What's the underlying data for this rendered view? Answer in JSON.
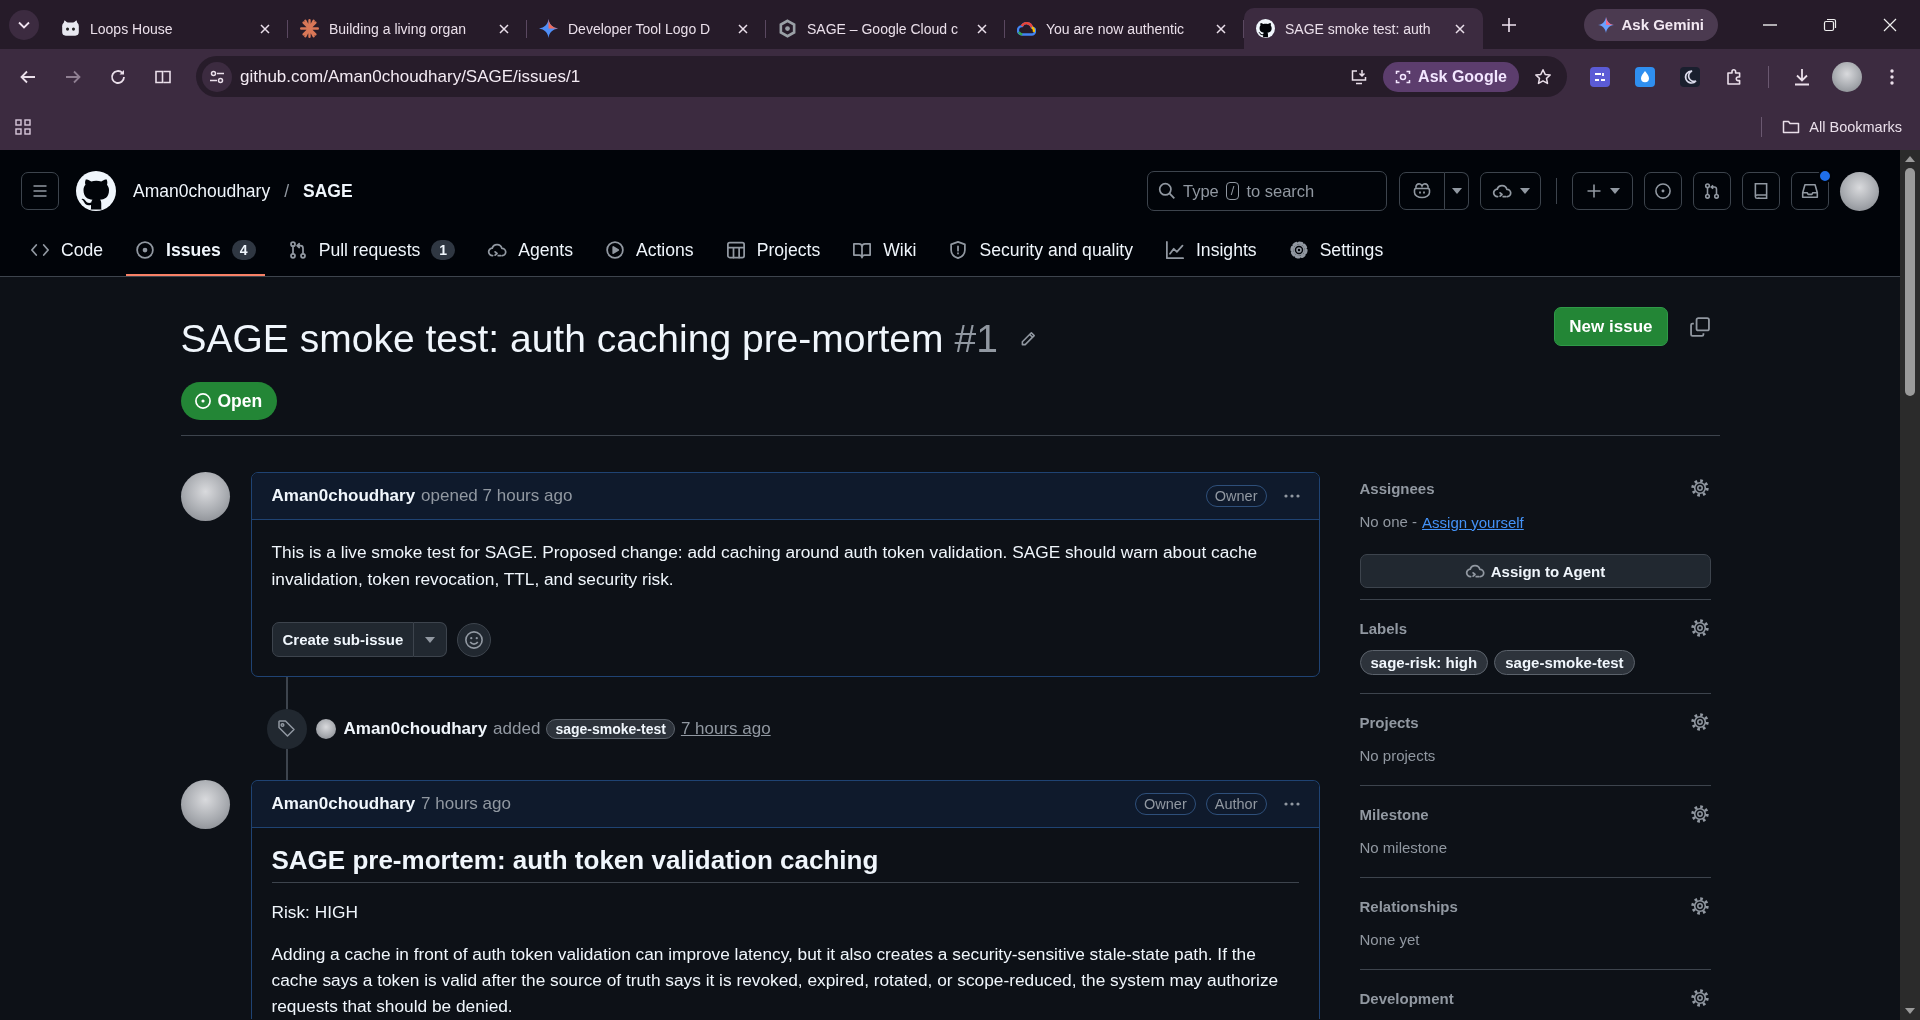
{
  "browser": {
    "tabs": [
      {
        "title": "Loops House",
        "selected": false
      },
      {
        "title": "Building a living organ",
        "selected": false
      },
      {
        "title": "Developer Tool Logo D",
        "selected": false
      },
      {
        "title": "SAGE – Google Cloud c",
        "selected": false
      },
      {
        "title": "You are now authentic",
        "selected": false
      },
      {
        "title": "SAGE smoke test: auth",
        "selected": true
      }
    ],
    "ask_gemini": "Ask Gemini",
    "url": "github.com/Aman0choudhary/SAGE/issues/1",
    "ask_google": "Ask Google",
    "all_bookmarks": "All Bookmarks"
  },
  "header": {
    "owner": "Aman0choudhary",
    "separator": "/",
    "repo": "SAGE",
    "search": {
      "hint_start": "Type",
      "key": "/",
      "hint_end": "to search"
    },
    "inbox": {
      "unread": true
    }
  },
  "repo_nav": [
    {
      "label": "Code",
      "selected": false
    },
    {
      "label": "Issues",
      "counter": "4",
      "selected": true
    },
    {
      "label": "Pull requests",
      "counter": "1",
      "selected": false
    },
    {
      "label": "Agents",
      "selected": false
    },
    {
      "label": "Actions",
      "selected": false
    },
    {
      "label": "Projects",
      "selected": false
    },
    {
      "label": "Wiki",
      "selected": false
    },
    {
      "label": "Security and quality",
      "selected": false
    },
    {
      "label": "Insights",
      "selected": false
    },
    {
      "label": "Settings",
      "selected": false
    }
  ],
  "issue": {
    "title": "SAGE smoke test: auth caching pre-mortem",
    "number": "#1",
    "new_issue": "New issue",
    "state": {
      "kind": "open",
      "label": "Open"
    }
  },
  "timeline": [
    {
      "kind": "comment",
      "author": "Aman0choudhary",
      "meta": "opened 7 hours ago",
      "badges": [
        "Owner"
      ],
      "body": [
        {
          "kind": "paragraph",
          "text": "This is a live smoke test for SAGE. Proposed change: add caching around auth token validation. SAGE should warn about cache invalidation, token revocation, TTL, and security risk."
        }
      ],
      "sub_issue_button": "Create sub-issue"
    },
    {
      "kind": "event",
      "actor": "Aman0choudhary",
      "verb": "added",
      "label": "sage-smoke-test",
      "time": "7 hours ago"
    },
    {
      "kind": "comment",
      "author": "Aman0choudhary",
      "meta": "7 hours ago",
      "badges": [
        "Owner",
        "Author"
      ],
      "body": [
        {
          "kind": "heading",
          "text": "SAGE pre-mortem: auth token validation caching"
        },
        {
          "kind": "paragraph",
          "text": "Risk: HIGH"
        },
        {
          "kind": "paragraph",
          "text": "Adding a cache in front of auth token validation can improve latency, but it also creates a security-sensitive stale-state path. If the cache says a token is valid after the source of truth says it is revoked, expired, rotated, or scope-reduced, the system may authorize requests that should be denied."
        }
      ]
    }
  ],
  "sidebar": [
    {
      "kind": "assignees",
      "heading": "Assignees",
      "text": "No one -",
      "link": "Assign yourself",
      "button": "Assign to Agent"
    },
    {
      "kind": "labels",
      "heading": "Labels",
      "labels": [
        "sage-risk: high",
        "sage-smoke-test"
      ]
    },
    {
      "kind": "note",
      "heading": "Projects",
      "text": "No projects"
    },
    {
      "kind": "note",
      "heading": "Milestone",
      "text": "No milestone"
    },
    {
      "kind": "note",
      "heading": "Relationships",
      "text": "None yet"
    },
    {
      "kind": "note",
      "heading": "Development"
    }
  ]
}
